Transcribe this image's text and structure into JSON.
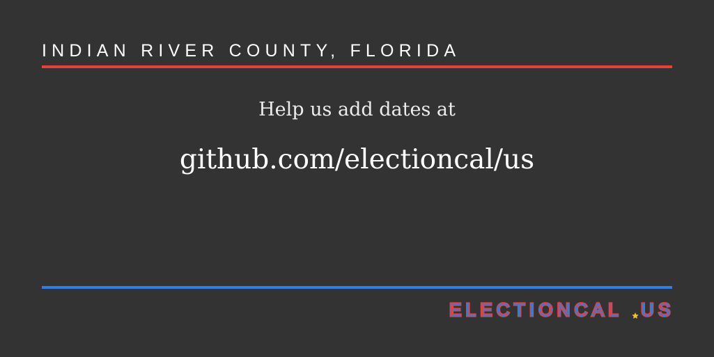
{
  "header": {
    "county_title": "INDIAN RIVER COUNTY, FLORIDA"
  },
  "main": {
    "help_text": "Help us add dates at",
    "repo_url": "github.com/electioncal/us"
  },
  "footer": {
    "logo_text": "ELECTIONCAL.US",
    "logo_label_left": "ELECTIONCAL",
    "logo_label_right": "US"
  },
  "colors": {
    "background": "#333333",
    "accent_red": "#e8413b",
    "accent_blue": "#2d7ee5",
    "star_yellow": "#f2c230",
    "text": "#ffffff"
  }
}
